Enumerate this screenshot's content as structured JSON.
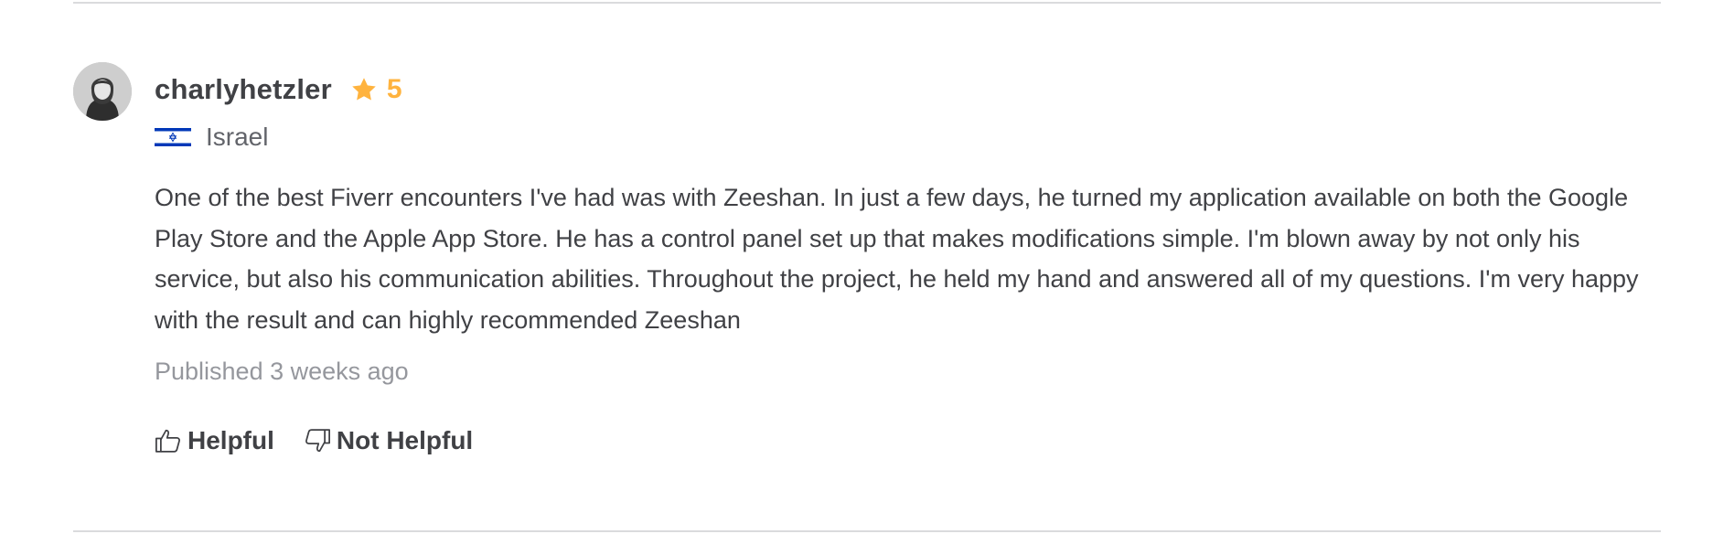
{
  "review": {
    "username": "charlyhetzler",
    "rating": "5",
    "country": "Israel",
    "text": "One of the best Fiverr encounters I've had was with Zeeshan. In just a few days, he turned my application available on both the Google Play Store and the Apple App Store. He has a control panel set up that makes modifications simple. I'm blown away by not only his service, but also his communication abilities. Throughout the project, he held my hand and answered all of my questions. I'm very happy with the result and can highly recommended Zeeshan",
    "published": "Published 3 weeks ago"
  },
  "votes": {
    "helpful_label": "Helpful",
    "not_helpful_label": "Not Helpful"
  },
  "icons": {
    "star": "star-icon",
    "flag": "israel-flag-icon",
    "helpful": "thumbs-up-icon",
    "not_helpful": "thumbs-down-icon"
  },
  "colors": {
    "rating": "#ffb33e",
    "text": "#404145",
    "muted": "#95979d",
    "divider": "#dadbdd",
    "flag_blue": "#0038b8"
  }
}
